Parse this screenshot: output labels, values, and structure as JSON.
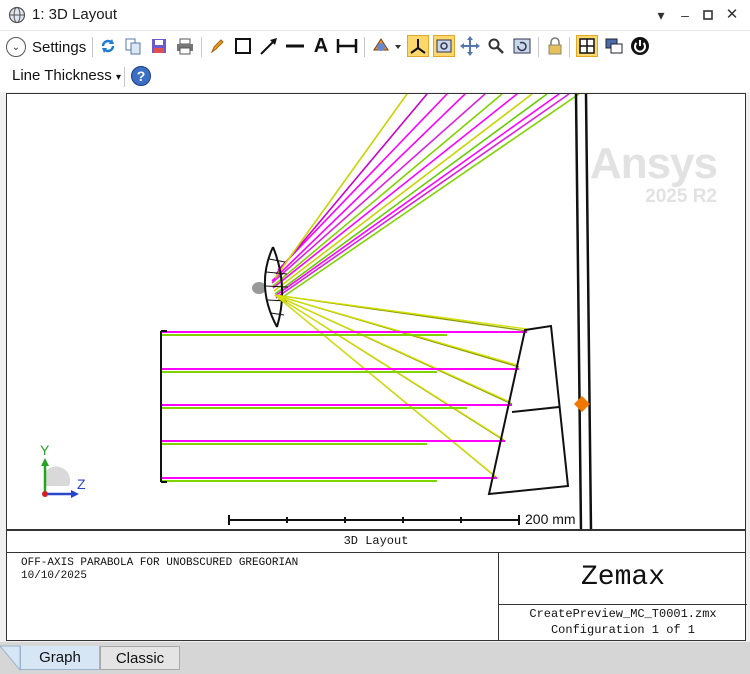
{
  "window": {
    "title": "1: 3D Layout"
  },
  "toolbar": {
    "settings_label": "Settings",
    "line_thickness_label": "Line Thickness",
    "icons": [
      "refresh-icon",
      "copy-icon",
      "save-icon",
      "print-icon",
      "pencil-icon",
      "rectangle-icon",
      "arrow-icon",
      "line-icon",
      "text-icon",
      "dimension-icon",
      "rotate-icon",
      "axes-icon",
      "zoom-fit-icon",
      "pan-icon",
      "zoom-icon",
      "reset-icon",
      "lock-icon",
      "layout-icon",
      "windows-icon",
      "power-icon",
      "help-icon"
    ]
  },
  "plot": {
    "watermark_brand": "Ansys",
    "watermark_version": "2025 R2",
    "scale_label": "200 mm",
    "axis_y": "Y",
    "axis_z": "Z"
  },
  "footer": {
    "caption": "3D Layout",
    "description": "OFF-AXIS PARABOLA FOR UNOBSCURED GREGORIAN",
    "date": "10/10/2025",
    "brand": "Zemax",
    "filename": "CreatePreview_MC_T0001.zmx",
    "configuration": "Configuration 1 of 1"
  },
  "tabs": [
    {
      "label": "Graph"
    },
    {
      "label": "Classic"
    }
  ],
  "colors": {
    "active_tool": "#fcd76b",
    "ray_magenta": "#ff00ff",
    "ray_green": "#7fd400",
    "ray_yellow": "#c8d400",
    "marker": "#f07800"
  }
}
